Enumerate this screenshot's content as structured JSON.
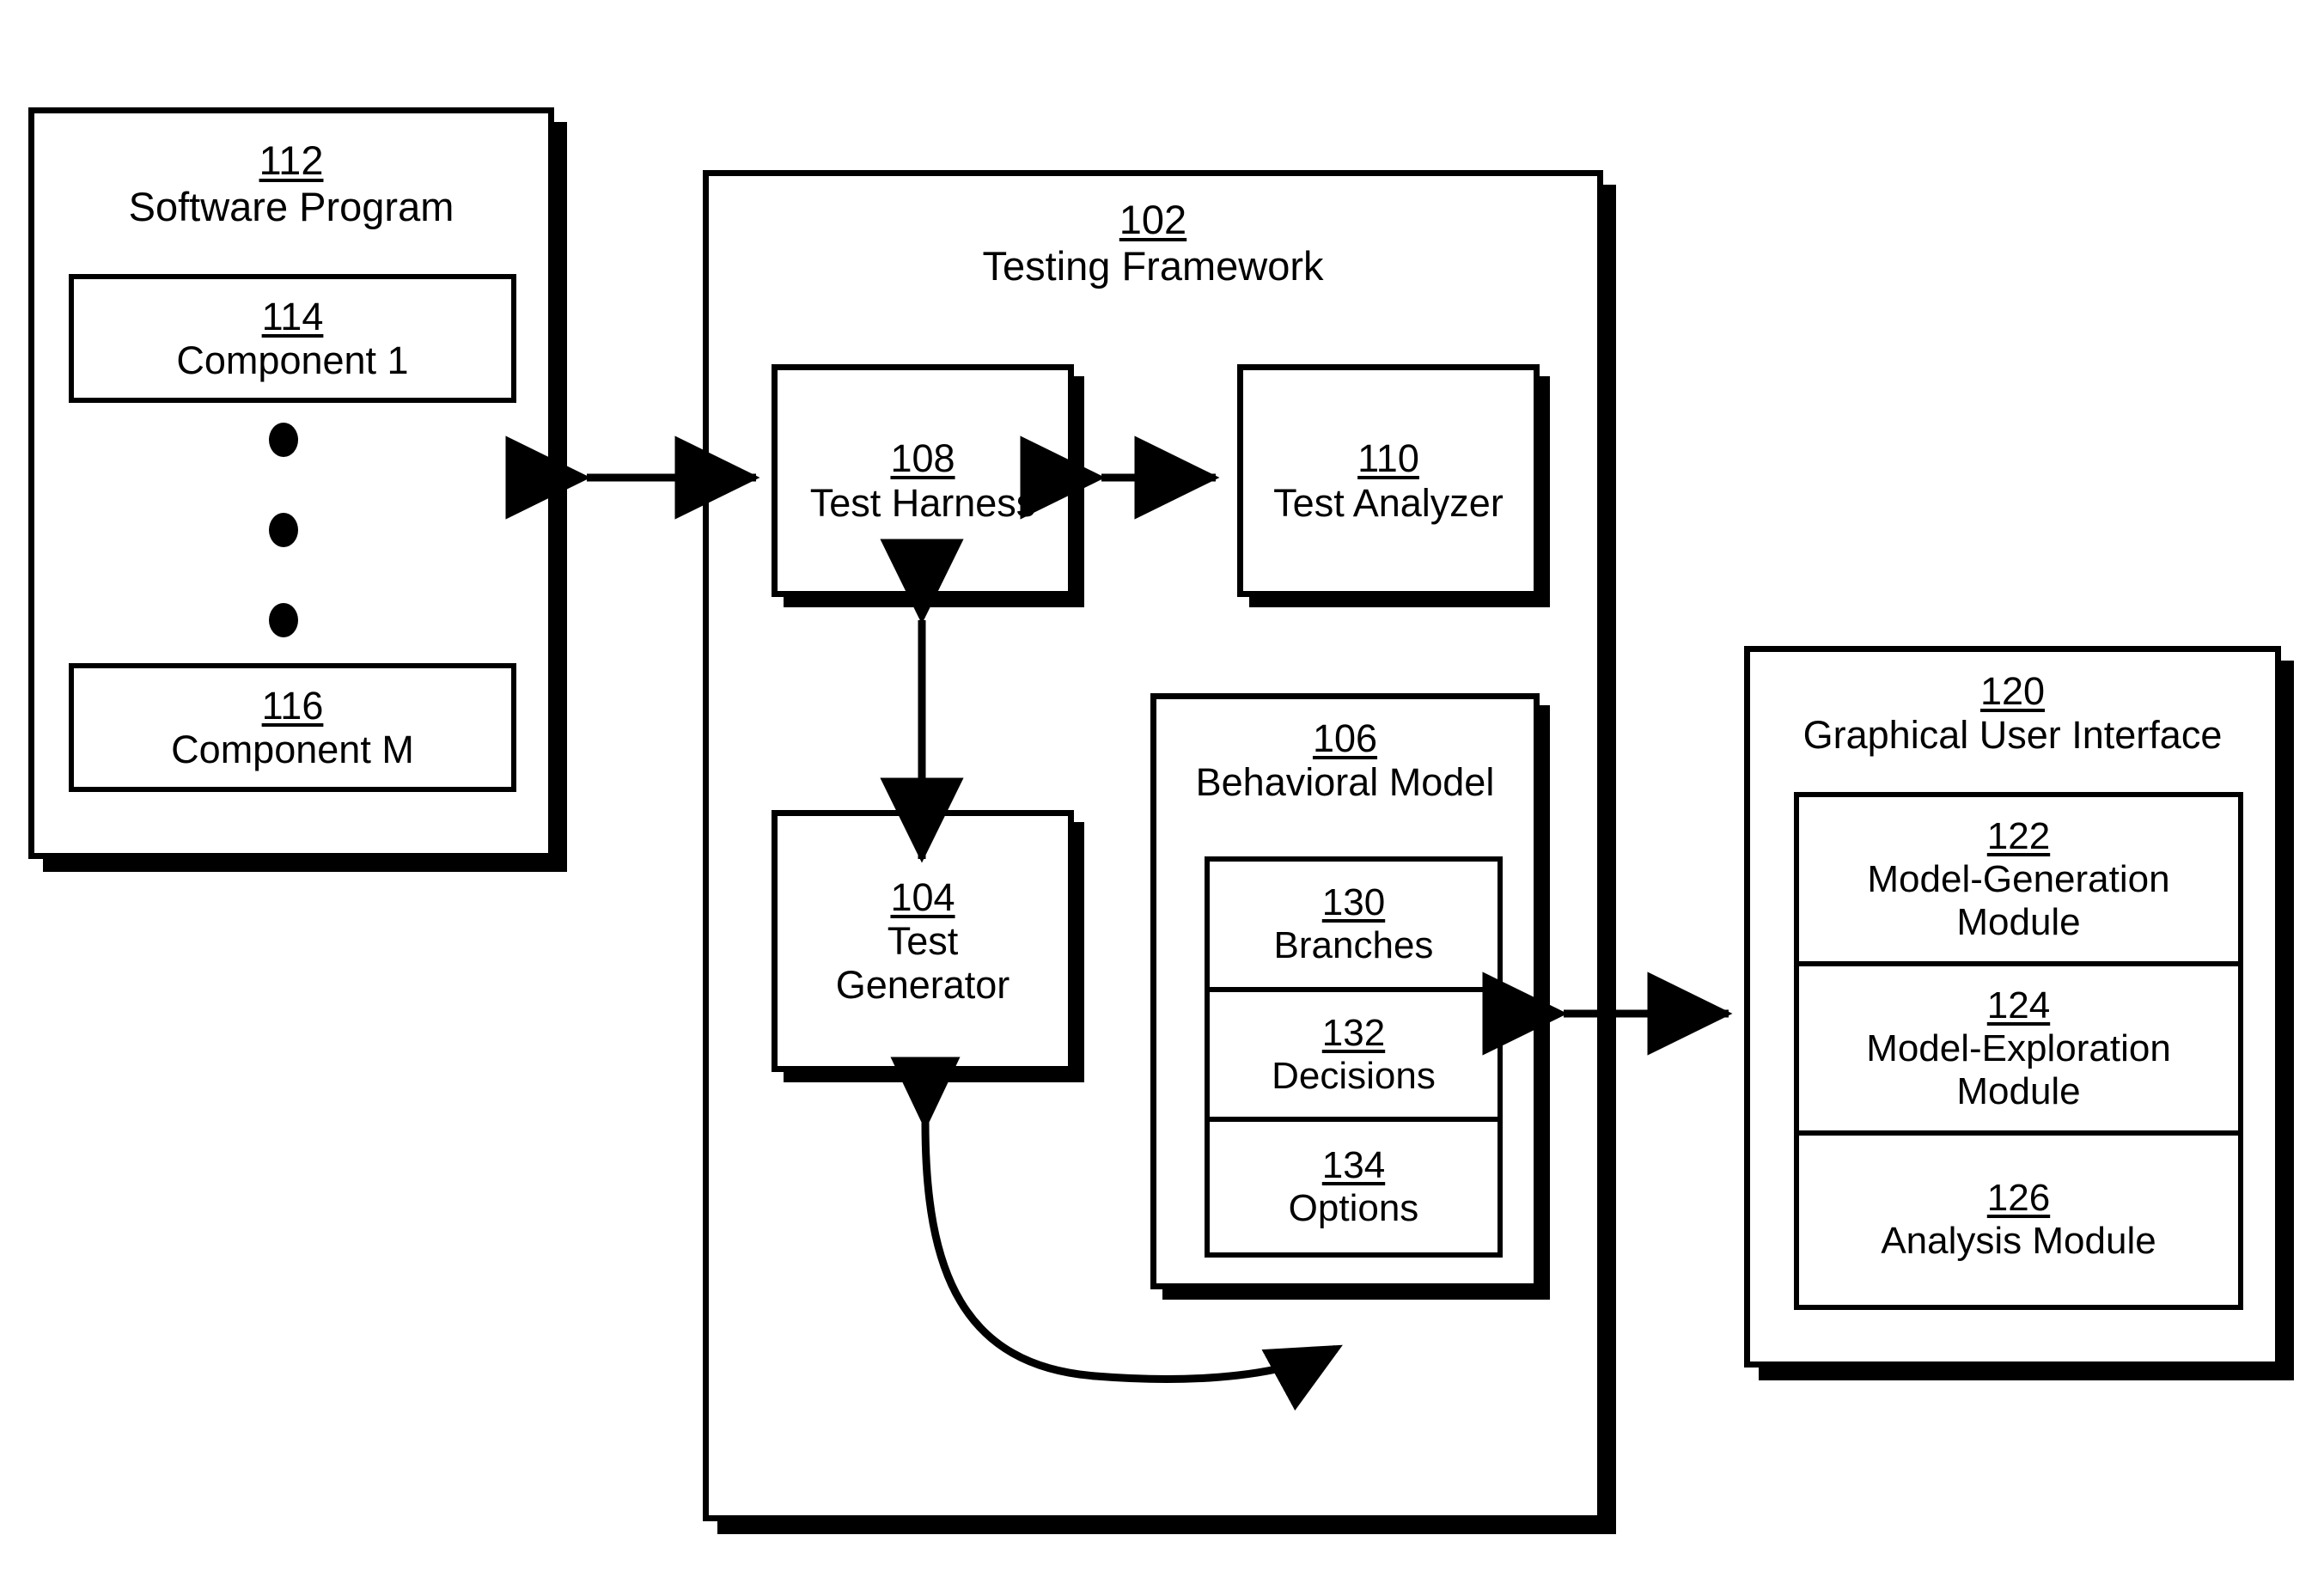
{
  "diagram": {
    "type": "patent-block-diagram",
    "blocks": {
      "software_program": {
        "ref": "112",
        "label": "Software Program",
        "components": [
          {
            "ref": "114",
            "label": "Component 1"
          },
          {
            "ref": "116",
            "label": "Component M"
          }
        ],
        "ellipsis_dots": 3
      },
      "testing_framework": {
        "ref": "102",
        "label": "Testing Framework",
        "test_harness": {
          "ref": "108",
          "label": "Test Harness"
        },
        "test_analyzer": {
          "ref": "110",
          "label": "Test Analyzer"
        },
        "test_generator": {
          "ref": "104",
          "label_line1": "Test",
          "label_line2": "Generator"
        },
        "behavioral_model": {
          "ref": "106",
          "label": "Behavioral Model",
          "items": [
            {
              "ref": "130",
              "label": "Branches"
            },
            {
              "ref": "132",
              "label": "Decisions"
            },
            {
              "ref": "134",
              "label": "Options"
            }
          ]
        }
      },
      "gui": {
        "ref": "120",
        "label": "Graphical User Interface",
        "modules": [
          {
            "ref": "122",
            "label_line1": "Model-Generation",
            "label_line2": "Module"
          },
          {
            "ref": "124",
            "label_line1": "Model-Exploration",
            "label_line2": "Module"
          },
          {
            "ref": "126",
            "label_line1": "Analysis Module",
            "label_line2": ""
          }
        ]
      }
    },
    "connectors": [
      {
        "name": "software-program-to-test-harness",
        "style": "double-arrow-horizontal"
      },
      {
        "name": "test-harness-to-test-analyzer",
        "style": "double-arrow-horizontal"
      },
      {
        "name": "test-harness-to-test-generator",
        "style": "double-arrow-vertical"
      },
      {
        "name": "test-generator-to-behavioral-model",
        "style": "double-arrow-curved"
      },
      {
        "name": "behavioral-model-to-gui",
        "style": "double-arrow-horizontal"
      }
    ],
    "colors": {
      "stroke": "#000000",
      "fill": "#ffffff"
    }
  }
}
